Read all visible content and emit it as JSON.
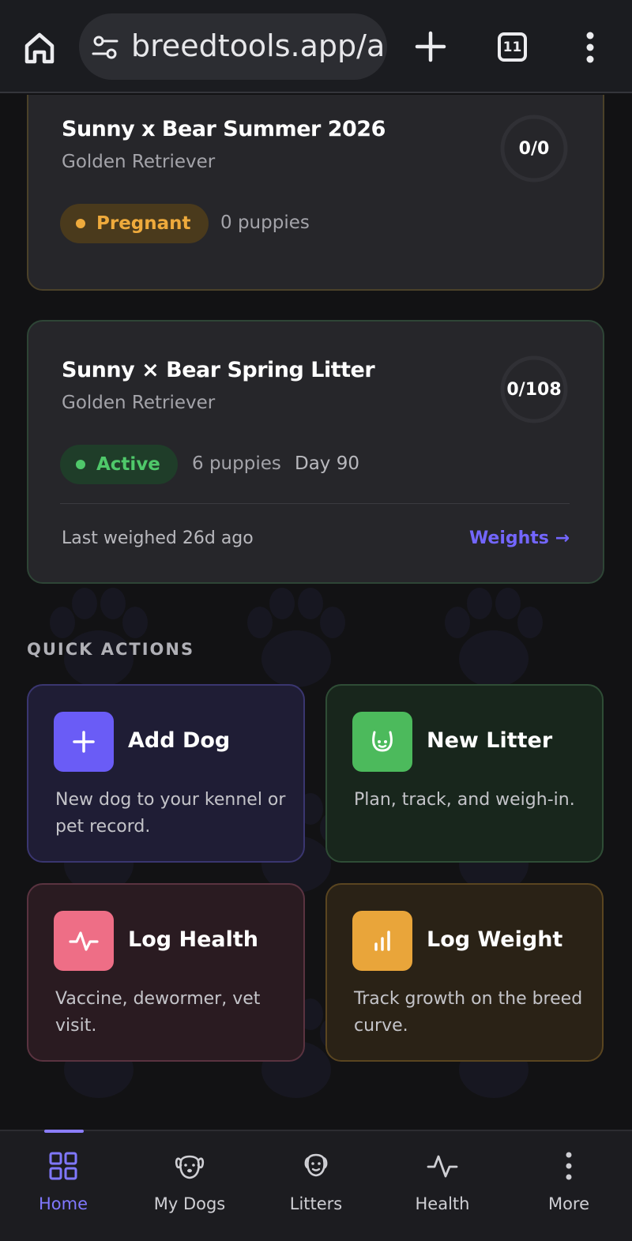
{
  "browser": {
    "url": "breedtools.app/a",
    "tab_count": "11"
  },
  "litters": [
    {
      "name": "Sunny x Bear Summer 2026",
      "breed": "Golden Retriever",
      "progress": "0/0",
      "status": "Pregnant",
      "puppies": "0 puppies",
      "accent": "#eeaa3c"
    },
    {
      "name": "Sunny × Bear Spring Litter",
      "breed": "Golden Retriever",
      "progress": "0/108",
      "status": "Active",
      "puppies": "6 puppies",
      "day": "Day 90",
      "last_weighed": "Last weighed 26d ago",
      "weights_link": "Weights →",
      "accent": "#4fc86a"
    }
  ],
  "quick_actions": {
    "title": "QUICK ACTIONS",
    "items": [
      {
        "title": "Add Dog",
        "desc": "New dog to your kennel or pet record.",
        "icon": "plus-icon",
        "color": "#6a5cf6"
      },
      {
        "title": "New Litter",
        "desc": "Plan, track, and weigh-in.",
        "icon": "puppy-face-icon",
        "color": "#4cba5c"
      },
      {
        "title": "Log Health",
        "desc": "Vaccine, dewormer, vet visit.",
        "icon": "pulse-icon",
        "color": "#ee6e86"
      },
      {
        "title": "Log Weight",
        "desc": "Track growth on the breed curve.",
        "icon": "bar-chart-icon",
        "color": "#e9a53a"
      }
    ]
  },
  "nav": {
    "items": [
      {
        "label": "Home",
        "icon": "grid-icon",
        "active": true
      },
      {
        "label": "My Dogs",
        "icon": "dog-face-icon",
        "active": false
      },
      {
        "label": "Litters",
        "icon": "puppy-icon",
        "active": false
      },
      {
        "label": "Health",
        "icon": "pulse-icon",
        "active": false
      },
      {
        "label": "More",
        "icon": "more-vertical-icon",
        "active": false
      }
    ]
  }
}
